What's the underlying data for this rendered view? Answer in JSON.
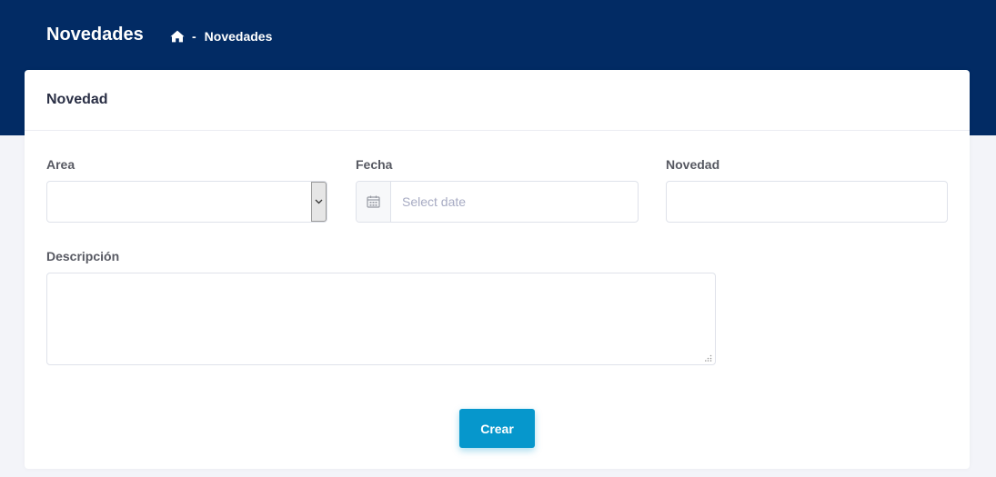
{
  "header": {
    "title": "Novedades",
    "breadcrumb": {
      "home_icon": "home-icon",
      "separator": "-",
      "current": "Novedades"
    }
  },
  "card": {
    "title": "Novedad",
    "form": {
      "area": {
        "label": "Area",
        "value": ""
      },
      "fecha": {
        "label": "Fecha",
        "placeholder": "Select date",
        "value": "",
        "icon": "calendar-icon"
      },
      "novedad": {
        "label": "Novedad",
        "value": ""
      },
      "descripcion": {
        "label": "Descripción",
        "value": ""
      }
    },
    "submit_label": "Crear"
  },
  "colors": {
    "header_bg": "#022b64",
    "page_bg": "#f3f4f9",
    "accent": "#0697cc",
    "card_bg": "#ffffff"
  }
}
